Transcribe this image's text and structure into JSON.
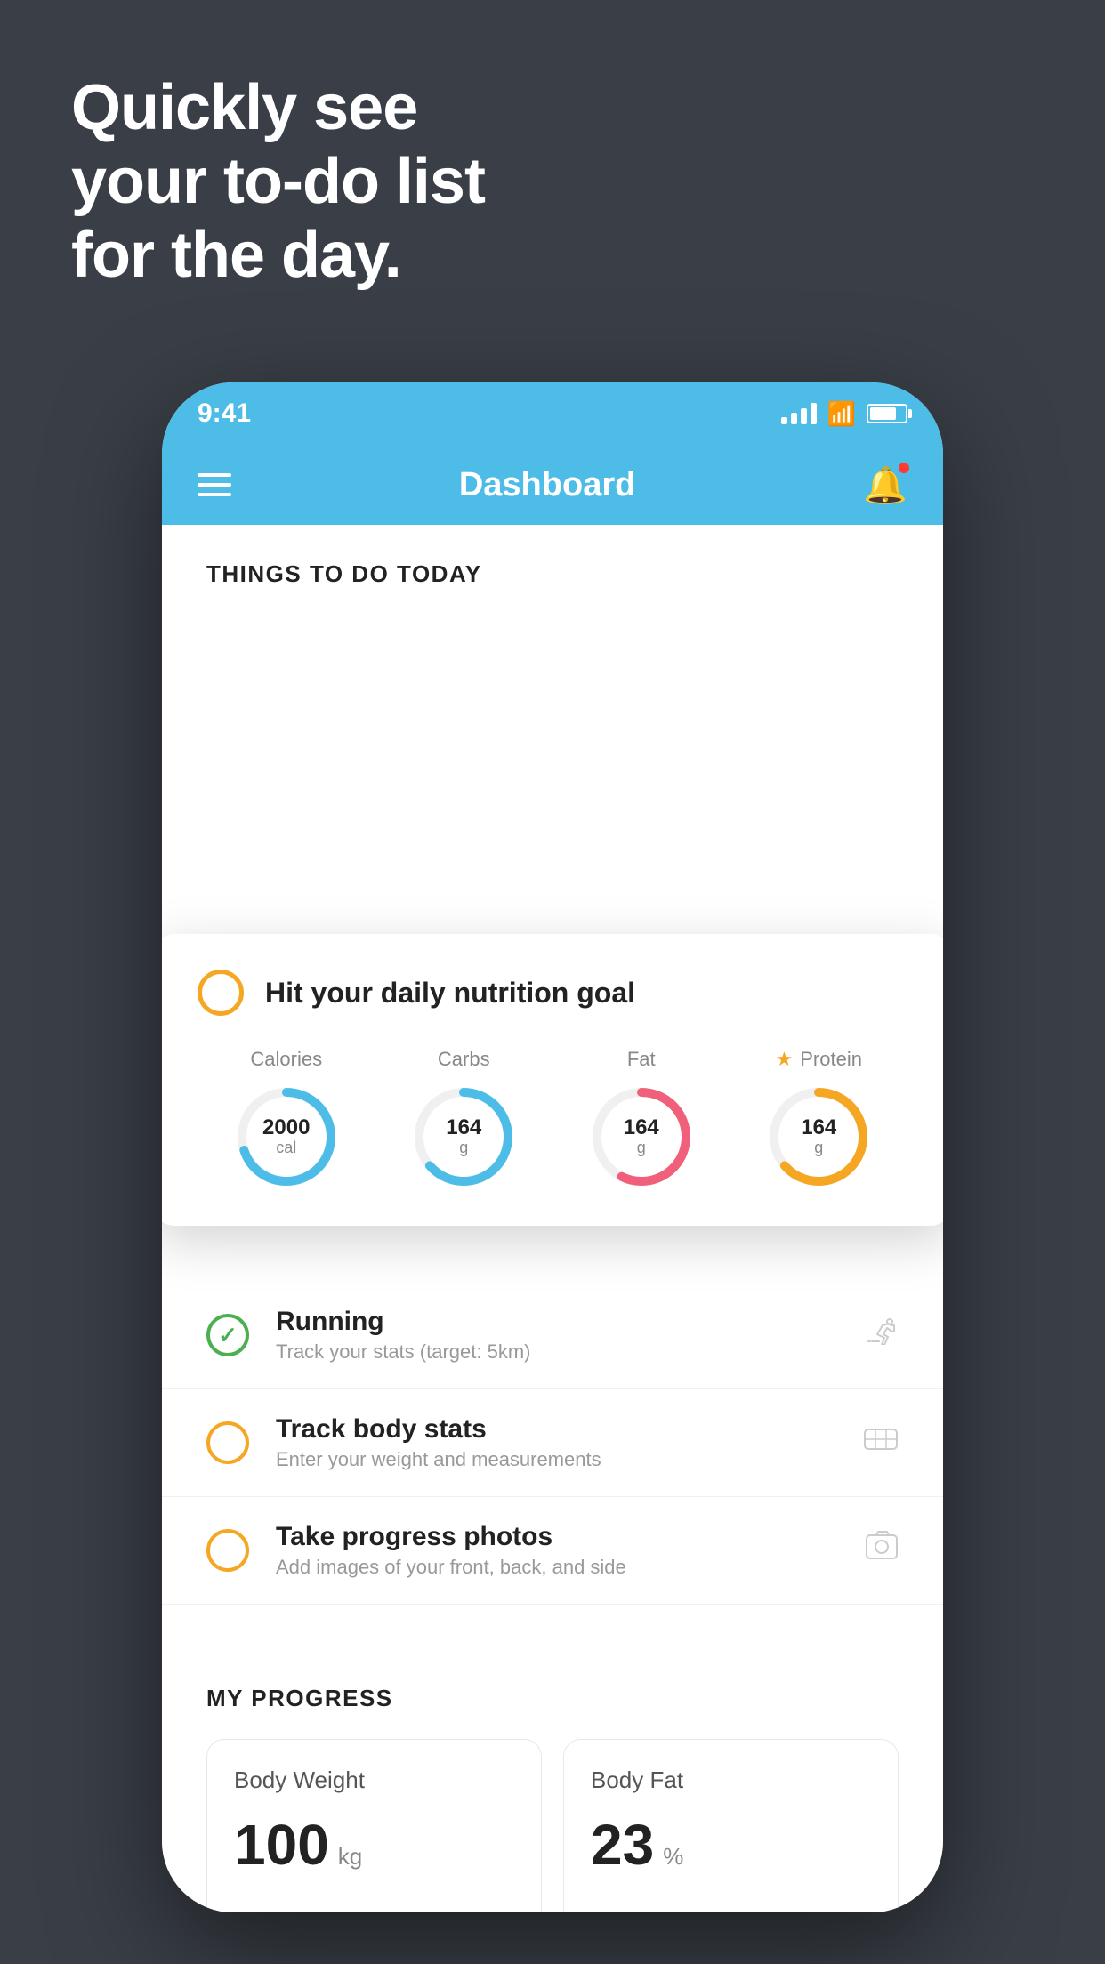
{
  "hero": {
    "line1": "Quickly see",
    "line2": "your to-do list",
    "line3": "for the day."
  },
  "phone": {
    "statusBar": {
      "time": "9:41"
    },
    "navBar": {
      "title": "Dashboard"
    },
    "thingsToDoHeader": "THINGS TO DO TODAY",
    "floatingCard": {
      "checkStatus": "incomplete",
      "title": "Hit your daily nutrition goal",
      "nutrition": [
        {
          "label": "Calories",
          "value": "2000",
          "unit": "cal",
          "color": "blue"
        },
        {
          "label": "Carbs",
          "value": "164",
          "unit": "g",
          "color": "blue"
        },
        {
          "label": "Fat",
          "value": "164",
          "unit": "g",
          "color": "pink"
        },
        {
          "label": "Protein",
          "value": "164",
          "unit": "g",
          "color": "gold",
          "starred": true
        }
      ]
    },
    "todoItems": [
      {
        "id": "running",
        "icon": "🏃",
        "title": "Running",
        "subtitle": "Track your stats (target: 5km)",
        "status": "complete"
      },
      {
        "id": "body-stats",
        "icon": "⚖",
        "title": "Track body stats",
        "subtitle": "Enter your weight and measurements",
        "status": "incomplete"
      },
      {
        "id": "progress-photos",
        "icon": "🖼",
        "title": "Take progress photos",
        "subtitle": "Add images of your front, back, and side",
        "status": "incomplete"
      }
    ],
    "myProgressHeader": "MY PROGRESS",
    "progressCards": [
      {
        "title": "Body Weight",
        "value": "100",
        "unit": "kg"
      },
      {
        "title": "Body Fat",
        "value": "23",
        "unit": "%"
      }
    ]
  }
}
